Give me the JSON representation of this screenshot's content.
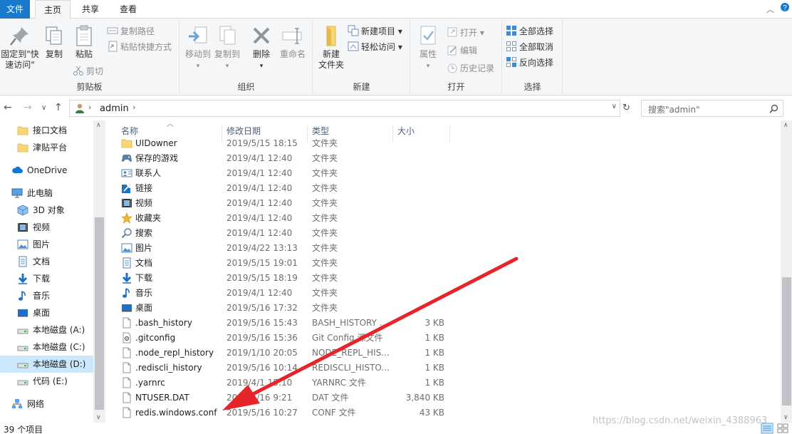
{
  "tabs": {
    "file": "文件",
    "home": "主页",
    "share": "共享",
    "view": "查看"
  },
  "ribbon": {
    "clipboard": {
      "pin": "固定到\"快",
      "pin2": "速访问\"",
      "copy": "复制",
      "paste": "粘贴",
      "copy_path": "复制路径",
      "paste_shortcut": "粘贴快捷方式",
      "cut": "剪切",
      "label": "剪贴板"
    },
    "organize": {
      "move_to": "移动到",
      "copy_to": "复制到",
      "delete": "删除",
      "rename": "重命名",
      "label": "组织"
    },
    "new": {
      "new_folder": "新建",
      "new_folder2": "文件夹",
      "new_item": "新建项目",
      "easy_access": "轻松访问",
      "label": "新建"
    },
    "open": {
      "properties": "属性",
      "open": "打开",
      "edit": "编辑",
      "history": "历史记录",
      "label": "打开"
    },
    "select": {
      "select_all": "全部选择",
      "select_none": "全部取消",
      "invert": "反向选择",
      "label": "选择"
    }
  },
  "address": {
    "path": "admin",
    "search_placeholder": "搜索\"admin\""
  },
  "nav": {
    "items": [
      {
        "label": "接口文档",
        "icon": "folder-icon"
      },
      {
        "label": "津贴平台",
        "icon": "folder-icon"
      },
      {
        "label": "OneDrive",
        "icon": "cloud-icon"
      },
      {
        "label": "此电脑",
        "icon": "pc-icon"
      },
      {
        "label": "3D 对象",
        "icon": "cube-icon"
      },
      {
        "label": "视频",
        "icon": "video-icon"
      },
      {
        "label": "图片",
        "icon": "picture-icon"
      },
      {
        "label": "文档",
        "icon": "document-icon"
      },
      {
        "label": "下载",
        "icon": "download-icon"
      },
      {
        "label": "音乐",
        "icon": "music-icon"
      },
      {
        "label": "桌面",
        "icon": "desktop-icon"
      },
      {
        "label": "本地磁盘 (A:)",
        "icon": "drive-icon"
      },
      {
        "label": "本地磁盘 (C:)",
        "icon": "drive-icon"
      },
      {
        "label": "本地磁盘 (D:)",
        "icon": "drive-icon"
      },
      {
        "label": "代码 (E:)",
        "icon": "drive-icon"
      },
      {
        "label": "网络",
        "icon": "network-icon"
      }
    ]
  },
  "columns": {
    "name": "名称",
    "date": "修改日期",
    "type": "类型",
    "size": "大小"
  },
  "files": [
    {
      "name": "UIDowner",
      "date": "2019/5/15 18:15",
      "type": "文件夹",
      "size": "",
      "icon": "folder-icon"
    },
    {
      "name": "保存的游戏",
      "date": "2019/4/1 12:40",
      "type": "文件夹",
      "size": "",
      "icon": "saved-games-icon"
    },
    {
      "name": "联系人",
      "date": "2019/4/1 12:40",
      "type": "文件夹",
      "size": "",
      "icon": "contacts-icon"
    },
    {
      "name": "链接",
      "date": "2019/4/1 12:40",
      "type": "文件夹",
      "size": "",
      "icon": "links-icon"
    },
    {
      "name": "视频",
      "date": "2019/4/1 12:40",
      "type": "文件夹",
      "size": "",
      "icon": "video-icon"
    },
    {
      "name": "收藏夹",
      "date": "2019/4/1 12:40",
      "type": "文件夹",
      "size": "",
      "icon": "favorites-icon"
    },
    {
      "name": "搜索",
      "date": "2019/4/1 12:40",
      "type": "文件夹",
      "size": "",
      "icon": "search-icon"
    },
    {
      "name": "图片",
      "date": "2019/4/22 13:13",
      "type": "文件夹",
      "size": "",
      "icon": "picture-icon"
    },
    {
      "name": "文档",
      "date": "2019/5/15 19:01",
      "type": "文件夹",
      "size": "",
      "icon": "document-icon"
    },
    {
      "name": "下载",
      "date": "2019/5/15 18:19",
      "type": "文件夹",
      "size": "",
      "icon": "download-icon"
    },
    {
      "name": "音乐",
      "date": "2019/4/1 12:40",
      "type": "文件夹",
      "size": "",
      "icon": "music-icon"
    },
    {
      "name": "桌面",
      "date": "2019/5/16 17:32",
      "type": "文件夹",
      "size": "",
      "icon": "desktop-icon"
    },
    {
      "name": ".bash_history",
      "date": "2019/5/16 15:43",
      "type": "BASH_HISTORY ...",
      "size": "3 KB",
      "icon": "file-icon"
    },
    {
      "name": ".gitconfig",
      "date": "2019/5/16 15:36",
      "type": "Git Config 源文件",
      "size": "1 KB",
      "icon": "config-file-icon"
    },
    {
      "name": ".node_repl_history",
      "date": "2019/1/10 20:05",
      "type": "NODE_REPL_HIS...",
      "size": "1 KB",
      "icon": "file-icon"
    },
    {
      "name": ".rediscli_history",
      "date": "2019/5/16 10:14",
      "type": "REDISCLI_HISTO...",
      "size": "1 KB",
      "icon": "file-icon"
    },
    {
      "name": ".yarnrc",
      "date": "2019/4/1 15:10",
      "type": "YARNRC 文件",
      "size": "1 KB",
      "icon": "file-icon"
    },
    {
      "name": "NTUSER.DAT",
      "date": "2019/5/16 9:21",
      "type": "DAT 文件",
      "size": "3,840 KB",
      "icon": "file-icon"
    },
    {
      "name": "redis.windows.conf",
      "date": "2019/5/16 10:27",
      "type": "CONF 文件",
      "size": "43 KB",
      "icon": "file-icon"
    }
  ],
  "status": {
    "count": "39 个项目"
  },
  "watermark": "https://blog.csdn.net/weixin_4388963",
  "colors": {
    "file_tab": "#1979ca",
    "selected": "#cce8ff",
    "folder": "#f8d775",
    "annotation_arrow": "#e8242b"
  }
}
